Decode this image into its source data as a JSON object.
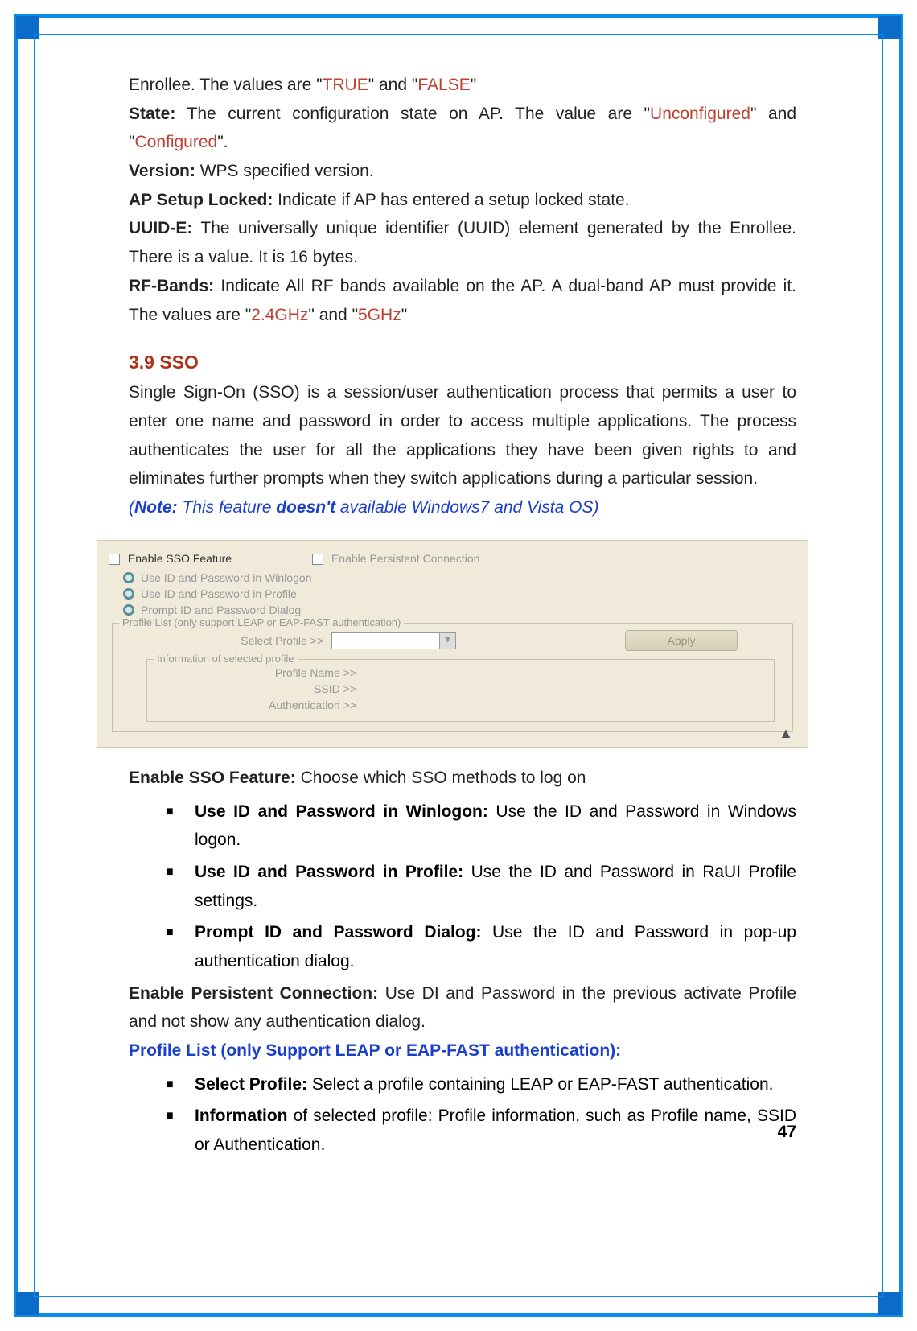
{
  "page_number": "47",
  "top_section": {
    "enrollee_prefix": "Enrollee. The values are \"",
    "true_val": "TRUE",
    "mid1": "\" and \"",
    "false_val": "FALSE",
    "end1": "\"",
    "state_label": "State:",
    "state_text1": " The current configuration state on AP. The value are \"",
    "unconfigured": "Unconfigured",
    "state_text2": "\" and \"",
    "configured": "Configured",
    "state_text3": "\".",
    "version_label": "Version:",
    "version_text": " WPS specified version.",
    "apsetup_label": "AP Setup Locked:",
    "apsetup_text": " Indicate if AP has entered a setup locked state.",
    "uuid_label": "UUID-E:",
    "uuid_text": " The universally unique identifier (UUID) element generated by the Enrollee. There is a value. It is 16 bytes.",
    "rfbands_label": "RF-Bands:",
    "rfbands_text1": " Indicate All RF bands available on the AP. A dual-band AP must provide it. The values are \"",
    "rf24": "2.4GHz",
    "rfbands_text2": "\" and \"",
    "rf5": "5GHz",
    "rfbands_text3": "\""
  },
  "section_heading": "3.9 SSO",
  "sso_para": "Single Sign-On (SSO) is a session/user authentication process that permits a user to enter one name and password in order to access multiple applications. The process authenticates the user for all the applications they have been given rights to and eliminates further prompts when they switch applications during a particular session.",
  "note": {
    "open": "(",
    "note_label": "Note:",
    "mid": " This feature ",
    "doesnt": "doesn't",
    "rest": " available Windows7 and Vista OS)"
  },
  "screenshot": {
    "enable_sso": "Enable SSO Feature",
    "enable_persistent": "Enable Persistent Connection",
    "opt1": "Use ID and Password in Winlogon",
    "opt2": "Use ID and Password in Profile",
    "opt3": "Prompt ID and Password Dialog",
    "fieldset_legend": "Profile List (only support LEAP or EAP-FAST authentication)",
    "select_profile": "Select Profile >>",
    "apply": "Apply",
    "inner_legend": "Information of selected profile",
    "profile_name": "Profile Name >>",
    "ssid": "SSID >>",
    "authentication": "Authentication >>",
    "collapse": "▲"
  },
  "lower": {
    "enable_sso_label": "Enable SSO Feature:",
    "enable_sso_text": " Choose which SSO methods to log on",
    "b1_label": "Use ID and Password in Winlogon:",
    "b1_text": " Use the ID and Password in Windows logon.",
    "b2_label": "Use ID and Password in Profile:",
    "b2_text": " Use the ID and Password in RaUI Profile settings.",
    "b3_label": "Prompt ID and Password Dialog:",
    "b3_text": " Use the ID and Password in pop-up authentication dialog.",
    "epc_label": "Enable Persistent Connection:",
    "epc_text": " Use DI and Password in the previous activate Profile and not show any authentication dialog.",
    "profile_list_head": "Profile List (only Support LEAP or EAP-FAST authentication):",
    "b4_label": "Select Profile:",
    "b4_text": " Select a profile containing LEAP or EAP-FAST authentication.",
    "b5_label": "Information",
    "b5_text": " of selected profile: Profile information, such as Profile name, SSID or Authentication."
  }
}
